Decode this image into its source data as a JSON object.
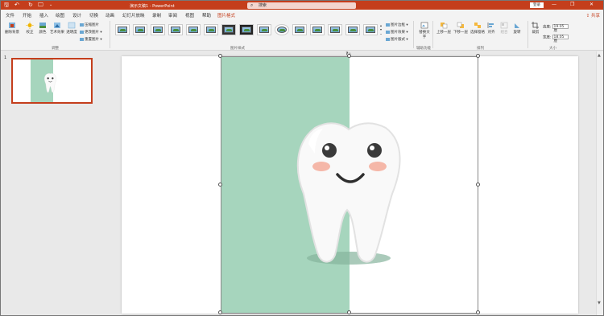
{
  "titlebar": {
    "doc_title": "演示文稿1  -  PowerPoint",
    "search_placeholder": "搜索",
    "login": "登录",
    "undo": "↶",
    "redo": "↻",
    "save": "🖫",
    "more": "⌄",
    "minimize": "—",
    "restore": "❐",
    "close": "✕"
  },
  "menu": [
    "文件",
    "开始",
    "插入",
    "绘图",
    "设计",
    "切换",
    "动画",
    "幻灯片放映",
    "录制",
    "审阅",
    "视图",
    "帮助",
    "图片格式"
  ],
  "share": "共享",
  "ribbon": {
    "adjust": {
      "remove_bg": "删除背景",
      "corrections": "校正",
      "color": "颜色",
      "artistic": "艺术效果",
      "transparency": "透明度",
      "compress": "压缩图片",
      "change": "更改图片",
      "reset": "重置图片",
      "label": "调整"
    },
    "styles": {
      "label": "图片样式",
      "border": "图片边框",
      "effects": "图片效果",
      "layout": "图片版式"
    },
    "access": {
      "alt_text": "替换文字",
      "label": "辅助功能"
    },
    "arrange": {
      "forward": "上移一层",
      "backward": "下移一层",
      "pane": "选择窗格",
      "align": "对齐",
      "group": "组合",
      "rotate": "旋转",
      "label": "排列"
    },
    "size": {
      "crop": "裁剪",
      "height_label": "高度:",
      "height": "19.05 厘",
      "width_label": "宽度:",
      "width": "18.05 厘",
      "label": "大小"
    }
  },
  "thumbnail": {
    "number": "1"
  },
  "colors": {
    "accent": "#c43e1c",
    "slide_green": "#a6d5bd"
  }
}
